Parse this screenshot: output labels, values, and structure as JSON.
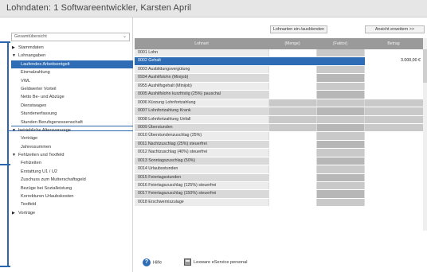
{
  "window": {
    "title": "Lohndaten: 1  Softwareentwickler, Karsten  April"
  },
  "sidebar": {
    "select_value": "Gesamtübersicht",
    "tree": [
      {
        "type": "cat",
        "label": "Stammdaten",
        "expanded": false
      },
      {
        "type": "cat",
        "label": "Lohnangaben",
        "expanded": true
      },
      {
        "type": "sub",
        "label": "Laufendes Arbeitsentgelt",
        "active": true
      },
      {
        "type": "sub",
        "label": "Einmalzahlung"
      },
      {
        "type": "sub",
        "label": "VWL"
      },
      {
        "type": "sub",
        "label": "Geldwerter Vorteil"
      },
      {
        "type": "sub",
        "label": "Netto Be- und Abzüge"
      },
      {
        "type": "sub",
        "label": "Dienstwagen"
      },
      {
        "type": "sub",
        "label": "Stundenerfassung"
      },
      {
        "type": "sub",
        "label": "Stunden Berufsgenossenschaft"
      },
      {
        "type": "cat",
        "label": "betriebliche Altersvorsorge",
        "expanded": true
      },
      {
        "type": "sub",
        "label": "Verträge"
      },
      {
        "type": "sub",
        "label": "Jahressummen"
      },
      {
        "type": "cat",
        "label": "Fehlzeiten und Textfeld",
        "expanded": true
      },
      {
        "type": "sub",
        "label": "Fehlzeiten"
      },
      {
        "type": "sub",
        "label": "Erstattung U1 / U2"
      },
      {
        "type": "sub",
        "label": "Zuschuss zum Mutterschaftsgeld"
      },
      {
        "type": "sub",
        "label": "Bezüge bei Sozialleistung"
      },
      {
        "type": "sub",
        "label": "Korrekturen Urlaubskosten"
      },
      {
        "type": "sub",
        "label": "Textfeld"
      },
      {
        "type": "cat",
        "label": "Vorträge",
        "expanded": false
      }
    ]
  },
  "toolbar": {
    "toggle_label": "Lohnarten ein-/ausblenden",
    "expand_label": "Ansicht erweitern >>"
  },
  "grid": {
    "headers": {
      "lohnart": "Lohnart",
      "menge": "(Menge)",
      "faktor": "(Faktor)",
      "betrag": "Betrag"
    },
    "rows": [
      {
        "name": "0001 Lohn",
        "betrag": ""
      },
      {
        "name": "0002 Gehalt",
        "betrag": "3.000,00 €",
        "selected": true
      },
      {
        "name": "0003 Ausbildungsvergütung",
        "betrag": ""
      },
      {
        "name": "0934 Aushilfslohn (Minijob)",
        "betrag": ""
      },
      {
        "name": "0955 Aushilfsgehalt (Minijob)",
        "betrag": ""
      },
      {
        "name": "0005 Aushilfslohn kurzfristig (25%) pauschal",
        "betrag": ""
      },
      {
        "name": "0006 Kürzung Lohnfortzahlung",
        "betrag": ""
      },
      {
        "name": "0007 Lohnfortzahlung Krank",
        "betrag": ""
      },
      {
        "name": "0008 Lohnfortzahlung Unfall",
        "betrag": ""
      },
      {
        "name": "0009 Überstunden",
        "betrag": ""
      },
      {
        "name": "0010 Überstundenzuschlag (25%)",
        "betrag": ""
      },
      {
        "name": "0011 Nachtzuschlag (25%) steuerfrei",
        "betrag": ""
      },
      {
        "name": "0012 Nachtzuschlag (40%) steuerfrei",
        "betrag": ""
      },
      {
        "name": "0013 Sonntagszuschlag (50%)",
        "betrag": ""
      },
      {
        "name": "0014 Urlaubsstunden",
        "betrag": ""
      },
      {
        "name": "0015 Feiertagsstunden",
        "betrag": ""
      },
      {
        "name": "0016 Feiertagszuschlag (125%) steuerfrei",
        "betrag": ""
      },
      {
        "name": "0017 Feiertagszuschlag (150%) steuerfrei",
        "betrag": ""
      },
      {
        "name": "0018 Erschwerniszulage",
        "betrag": ""
      }
    ]
  },
  "footer": {
    "help_label": "Hilfe",
    "service_label": "Lexware eService personal"
  },
  "colors": {
    "accent": "#2e6db5",
    "header_gray": "#9a9a9a"
  }
}
